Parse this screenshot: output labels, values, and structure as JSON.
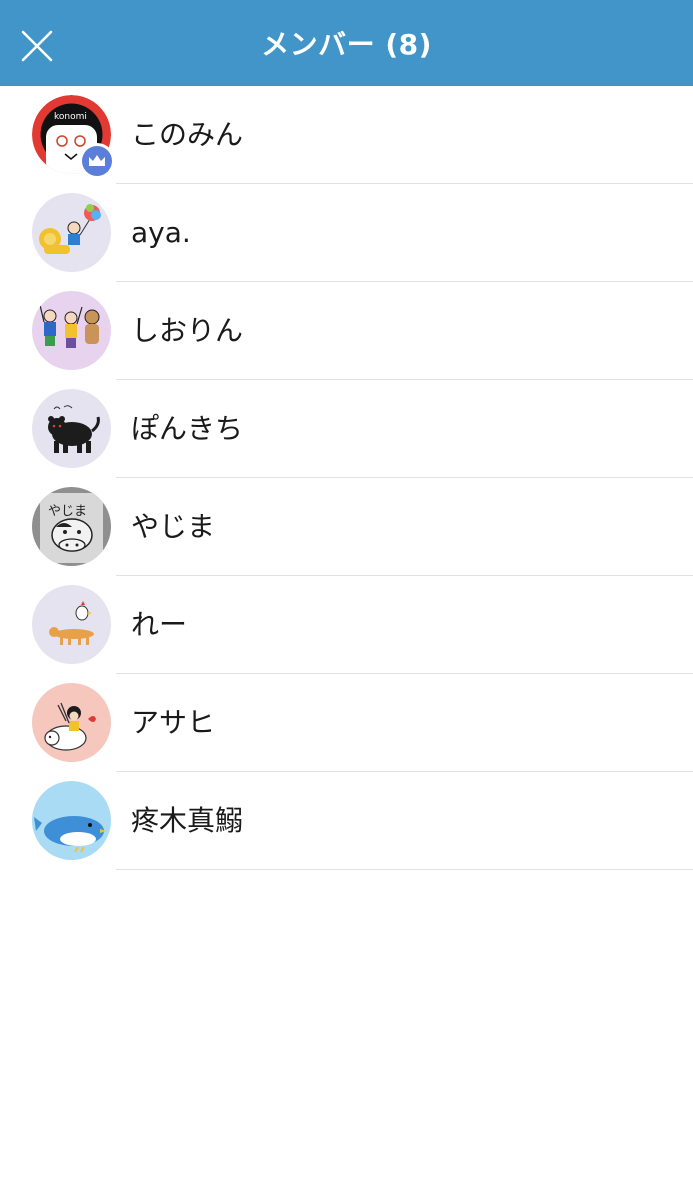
{
  "header": {
    "title": "メンバー (8)",
    "close_icon": "close-icon",
    "background_color": "#4195c8"
  },
  "members": [
    {
      "name": "このみん",
      "avatar": "avatar-konomi",
      "owner": true,
      "owner_icon": "crown-icon"
    },
    {
      "name": "aya.",
      "avatar": "avatar-lion-balloon",
      "owner": false
    },
    {
      "name": "しおりん",
      "avatar": "avatar-three-figures",
      "owner": false
    },
    {
      "name": "ぽんきち",
      "avatar": "avatar-black-panther",
      "owner": false
    },
    {
      "name": "やじま",
      "avatar": "avatar-cow-drawing",
      "owner": false
    },
    {
      "name": "れー",
      "avatar": "avatar-dog-chicken",
      "owner": false
    },
    {
      "name": "アサヒ",
      "avatar": "avatar-girl-on-sheep",
      "owner": false
    },
    {
      "name": "疼木真鰯",
      "avatar": "avatar-blue-bird",
      "owner": false
    }
  ]
}
